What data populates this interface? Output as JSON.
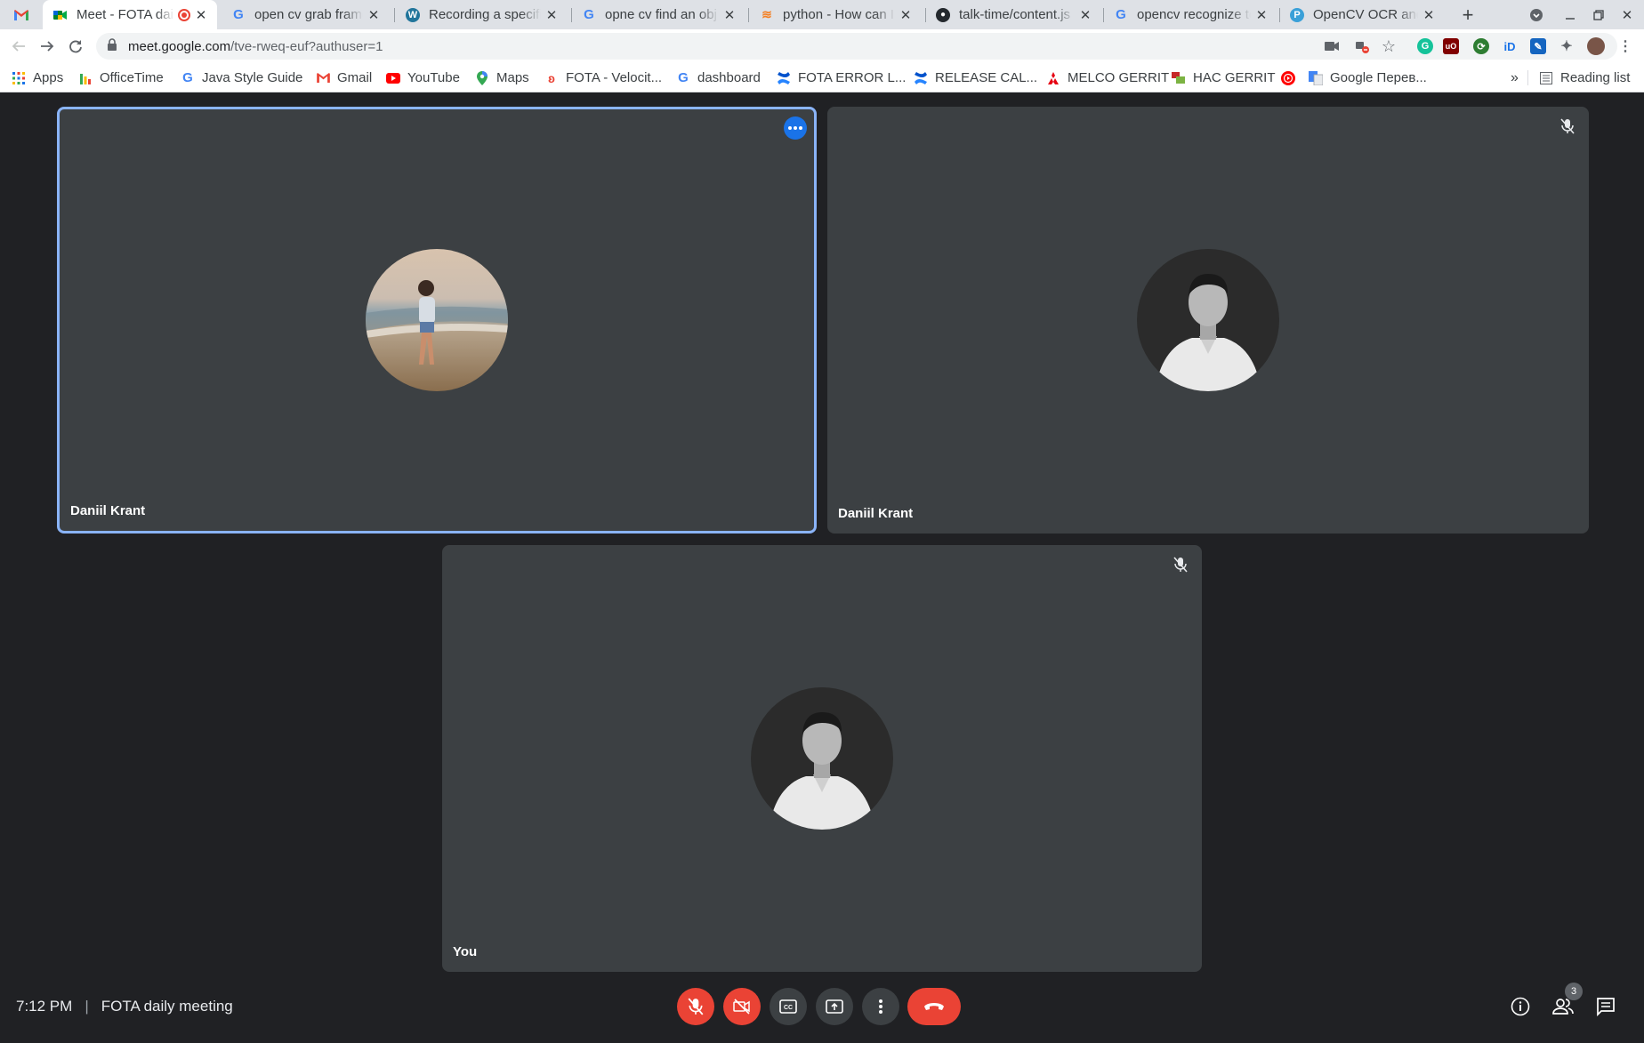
{
  "browser": {
    "tabs": [
      {
        "title": "",
        "icon": "gmail-icon"
      },
      {
        "title": "Meet - FOTA daily meeting",
        "icon": "google-meet-icon",
        "recording": true,
        "active": true
      },
      {
        "title": "open cv grab frame",
        "icon": "google-icon"
      },
      {
        "title": "Recording a specific",
        "icon": "wordpress-icon"
      },
      {
        "title": "opne cv find an obj",
        "icon": "google-icon"
      },
      {
        "title": "python - How can I",
        "icon": "stackoverflow-icon"
      },
      {
        "title": "talk-time/content.js",
        "icon": "github-icon"
      },
      {
        "title": "opencv recognize te",
        "icon": "google-icon"
      },
      {
        "title": "OpenCV OCR and te",
        "icon": "pyimagesearch-icon"
      }
    ],
    "new_tab_label": "+",
    "url_host": "meet.google.com",
    "url_path": "/tve-rweq-euf?authuser=1",
    "bookmarks": [
      {
        "label": "Apps",
        "icon": "apps-grid-icon"
      },
      {
        "label": "OfficeTime",
        "icon": "officetime-icon"
      },
      {
        "label": "Java Style Guide",
        "icon": "google-icon"
      },
      {
        "label": "Gmail",
        "icon": "gmail-icon"
      },
      {
        "label": "YouTube",
        "icon": "youtube-icon"
      },
      {
        "label": "Maps",
        "icon": "maps-icon"
      },
      {
        "label": "FOTA - Velocit...",
        "icon": "velocity-icon"
      },
      {
        "label": "dashboard",
        "icon": "google-icon"
      },
      {
        "label": "FOTA ERROR L...",
        "icon": "confluence-icon"
      },
      {
        "label": "RELEASE CAL...",
        "icon": "confluence-icon"
      },
      {
        "label": "MELCO GERRIT",
        "icon": "mitsubishi-icon"
      },
      {
        "label": "HAC GERRIT",
        "icon": "gerrit-icon"
      },
      {
        "label": "",
        "icon": "youtube-music-icon"
      },
      {
        "label": "Google Перев...",
        "icon": "google-translate-icon"
      }
    ],
    "overflow_label": "»",
    "reading_list_label": "Reading list"
  },
  "meet": {
    "participants": [
      {
        "name": "Daniil Krant",
        "speaking": true
      },
      {
        "name": "Daniil Krant",
        "muted": true
      },
      {
        "name": "You",
        "muted": true
      }
    ],
    "time": "7:12 PM",
    "separator": "|",
    "meeting_title": "FOTA daily meeting",
    "participant_count": "3"
  },
  "colors": {
    "meet_background": "#202124",
    "tile": "#3c4043",
    "active_speaker_border": "#8ab4f8",
    "danger_red": "#ea4335",
    "accent_blue": "#1a73e8"
  }
}
